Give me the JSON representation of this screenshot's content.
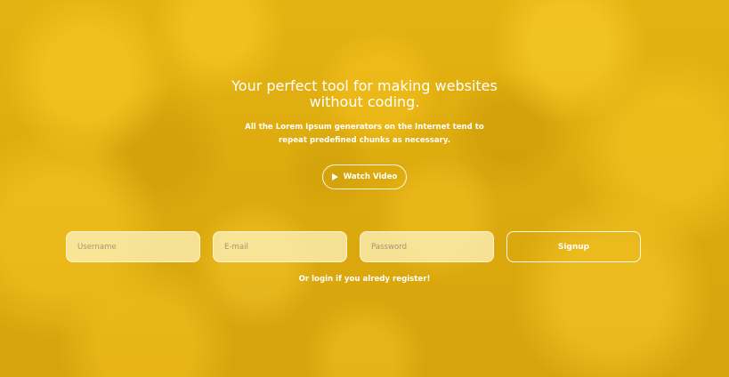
{
  "hero": {
    "title": "Your perfect tool for making websites without coding.",
    "subtitle": "All the Lorem Ipsum generators on the Internet tend to repeat predefined chunks as necessary.",
    "watch_label": "Watch Video"
  },
  "form": {
    "username_placeholder": "Username",
    "email_placeholder": "E-mail",
    "password_placeholder": "Password",
    "signup_label": "Signup"
  },
  "login_text": "Or login if you alredy register!",
  "colors": {
    "background": "#d9a80f",
    "input_fill": "#f5ecc4",
    "text": "#ffffff"
  }
}
